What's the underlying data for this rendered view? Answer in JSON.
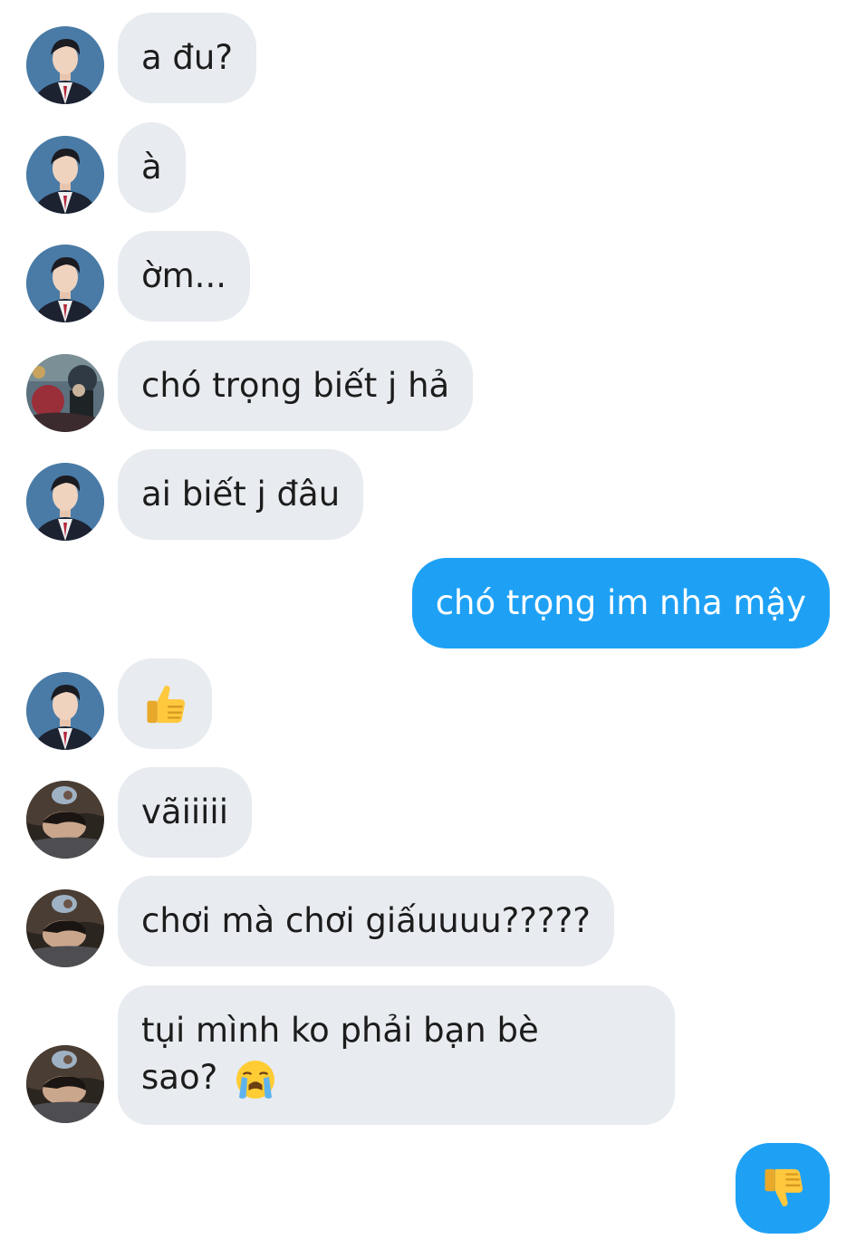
{
  "messages": [
    {
      "sender": "them",
      "avatar": "avatar-suit",
      "text": "a đu?"
    },
    {
      "sender": "them",
      "avatar": "avatar-suit",
      "text": "à"
    },
    {
      "sender": "them",
      "avatar": "avatar-suit",
      "text": "ờm..."
    },
    {
      "sender": "them",
      "avatar": "avatar-art",
      "text": "chó trọng biết j hả"
    },
    {
      "sender": "them",
      "avatar": "avatar-suit",
      "text": "ai biết j đâu"
    },
    {
      "sender": "me",
      "text": "chó trọng im nha mậy"
    },
    {
      "sender": "them",
      "avatar": "avatar-suit",
      "emoji": "thumbs-up-icon"
    },
    {
      "sender": "them",
      "avatar": "avatar-sleep",
      "text": "vãiiiii"
    },
    {
      "sender": "them",
      "avatar": "avatar-sleep",
      "text": "chơi mà chơi giấuuuu?????"
    },
    {
      "sender": "them",
      "avatar": "avatar-sleep",
      "text_line1": "tụi mình ko phải bạn bè",
      "text_line2": "sao?",
      "emoji": "loudly-crying-face-icon"
    },
    {
      "sender": "me",
      "emoji": "thumbs-down-icon"
    }
  ],
  "colors": {
    "incoming_bubble": "#e8ebef",
    "outgoing_bubble": "#1ea1f5",
    "incoming_text": "#1c1c1c",
    "outgoing_text": "#ffffff"
  }
}
